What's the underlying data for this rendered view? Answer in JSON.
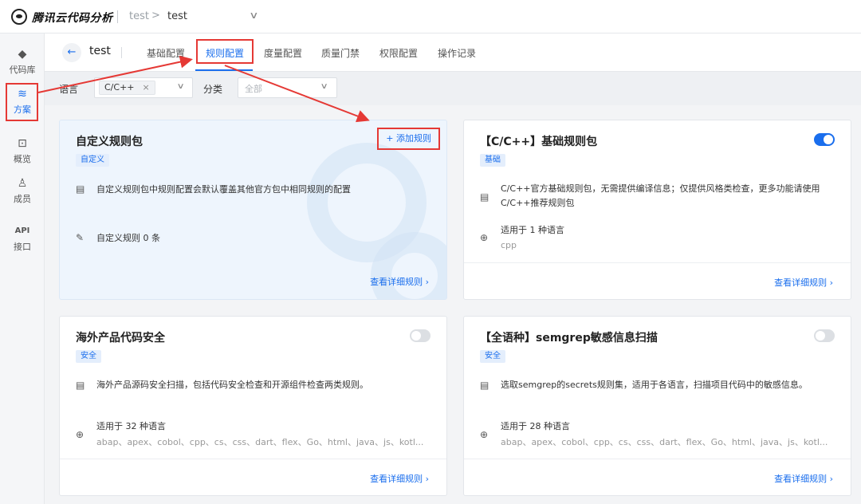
{
  "topbar": {
    "brand": "腾讯云代码分析",
    "crumb_1": "test",
    "crumb_arrow": ">",
    "crumb_2": "test",
    "dropdown_icon": "chevron-down-icon"
  },
  "sidebar": {
    "items": [
      {
        "label": "代码库",
        "icon": "git-icon"
      },
      {
        "label": "方案",
        "icon": "layers-icon",
        "active": true
      },
      {
        "label": "概览",
        "icon": "overview-icon"
      },
      {
        "label": "成员",
        "icon": "user-icon"
      },
      {
        "label": "接口",
        "icon_text": "API"
      }
    ]
  },
  "subheader": {
    "project": "test",
    "tabs": [
      {
        "label": "基础配置"
      },
      {
        "label": "规则配置",
        "active": true
      },
      {
        "label": "度量配置"
      },
      {
        "label": "质量门禁"
      },
      {
        "label": "权限配置"
      },
      {
        "label": "操作记录"
      }
    ]
  },
  "filters": {
    "language_label": "语言",
    "language_chip": "C/C++",
    "language_chip_close": "×",
    "category_label": "分类",
    "category_placeholder": "全部"
  },
  "cards": [
    {
      "title": "自定义规则包",
      "tag": "自定义",
      "add_button": "+ 添加规则",
      "description": "自定义规则包中规则配置会默认覆盖其他官方包中相同规则的配置",
      "count_text": "自定义规则 0 条",
      "link": "查看详细规则"
    },
    {
      "title": "【C/C++】基础规则包",
      "tag": "基础",
      "enabled": true,
      "description": "C/C++官方基础规则包，无需提供编译信息；仅提供风格类检查，更多功能请使用C/C++推荐规则包",
      "lang_text": "适用于 1 种语言",
      "lang_list": "cpp",
      "link": "查看详细规则"
    },
    {
      "title": "海外产品代码安全",
      "tag": "安全",
      "enabled": false,
      "description": "海外产品源码安全扫描，包括代码安全检查和开源组件检查两类规则。",
      "lang_text": "适用于 32 种语言",
      "lang_list": "abap、apex、cobol、cpp、cs、css、dart、flex、Go、html、java、js、kotl...",
      "link": "查看详细规则"
    },
    {
      "title": "【全语种】semgrep敏感信息扫描",
      "tag": "安全",
      "enabled": false,
      "description": "选取semgrep的secrets规则集，适用于各语言，扫描项目代码中的敏感信息。",
      "lang_text": "适用于 28 种语言",
      "lang_list": "abap、apex、cobol、cpp、cs、css、dart、flex、Go、html、java、js、kotl...",
      "link": "查看详细规则"
    }
  ],
  "colors": {
    "accent": "#1a6eed",
    "annotation": "#e53935"
  }
}
